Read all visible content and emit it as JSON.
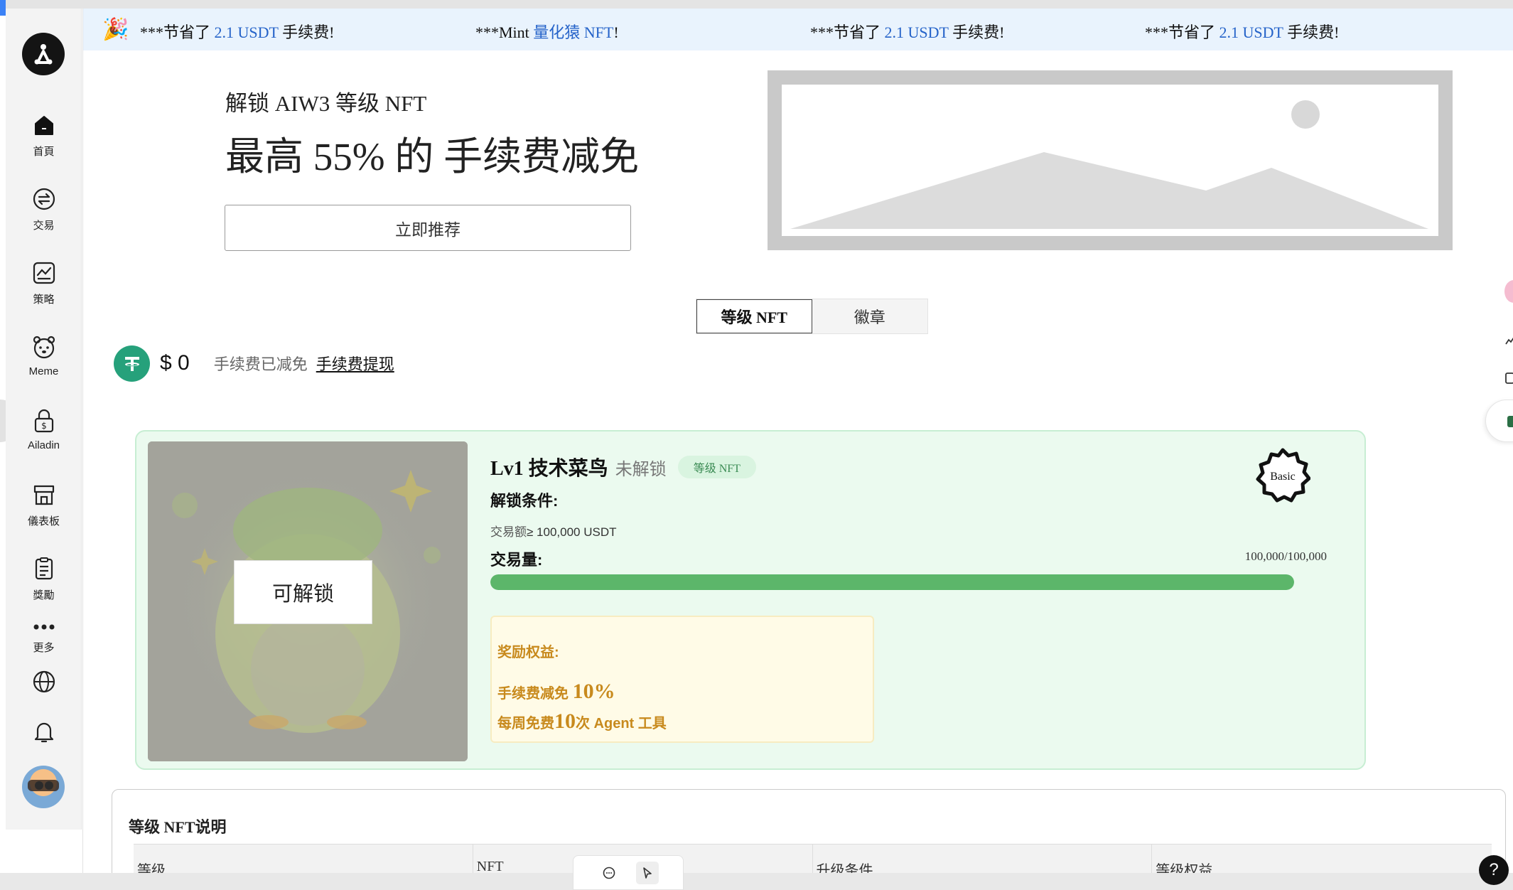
{
  "ticker": {
    "party_icon": "party-popper-icon",
    "messages": [
      {
        "prefix": "***节省了 ",
        "highlight": "2.1 USDT",
        "suffix": " 手续费!"
      },
      {
        "prefix": "***Mint ",
        "highlight": "量化猿 NFT",
        "suffix": "!"
      },
      {
        "prefix": "***节省了 ",
        "highlight": "2.1 USDT",
        "suffix": " 手续费!"
      },
      {
        "prefix": "***节省了 ",
        "highlight": "2.1 USDT",
        "suffix": " 手续费!"
      }
    ],
    "highlight_color": "#2563c9"
  },
  "sidebar": {
    "items": [
      {
        "label": "首頁",
        "icon": "home-icon"
      },
      {
        "label": "交易",
        "icon": "exchange-icon"
      },
      {
        "label": "策略",
        "icon": "strategy-chart-icon"
      },
      {
        "label": "Meme",
        "icon": "meme-face-icon"
      },
      {
        "label": "Ailadin",
        "icon": "lock-dollar-icon"
      },
      {
        "label": "儀表板",
        "icon": "store-icon"
      },
      {
        "label": "獎勵",
        "icon": "clipboard-icon"
      },
      {
        "label": "更多",
        "icon": "more-dots-icon"
      }
    ],
    "globe_icon": "globe-icon",
    "bell_icon": "bell-icon"
  },
  "hero": {
    "subtitle": "解锁 AIW3 等级 NFT",
    "title": "最高 55% 的 手续费减免",
    "button": "立即推荐"
  },
  "tabs": [
    {
      "label": "等级 NFT",
      "active": true
    },
    {
      "label": "徽章",
      "active": false
    }
  ],
  "fee": {
    "amount": "$ 0",
    "label": "手续费已减免",
    "link": "手续费提现"
  },
  "nft_card": {
    "unlock_button": "可解锁",
    "name": "Lv1 技术菜鸟",
    "status": "未解锁",
    "badge": "等级 NFT",
    "condition_title": "解锁条件:",
    "condition_key": "交易额",
    "condition_value": "≥ 100,000 USDT",
    "volume_title": "交易量:",
    "volume_value": "100,000/100,000",
    "progress_fraction": 1.0,
    "reward_title": "奖励权益:",
    "reward_fee_prefix": "手续费减免 ",
    "reward_fee_value": "10%",
    "reward_agent_prefix": "每周免费",
    "reward_agent_value": "10",
    "reward_agent_suffix": "次 Agent 工具",
    "tier_badge": "Basic",
    "colors": {
      "card_bg": "#ebfaef",
      "progress": "#5cb66a",
      "reward_text": "#c88a1d"
    }
  },
  "nft_table": {
    "title": "等级 NFT说明",
    "columns": [
      "等级",
      "NFT",
      "升级条件",
      "等级权益"
    ]
  },
  "help": "?"
}
